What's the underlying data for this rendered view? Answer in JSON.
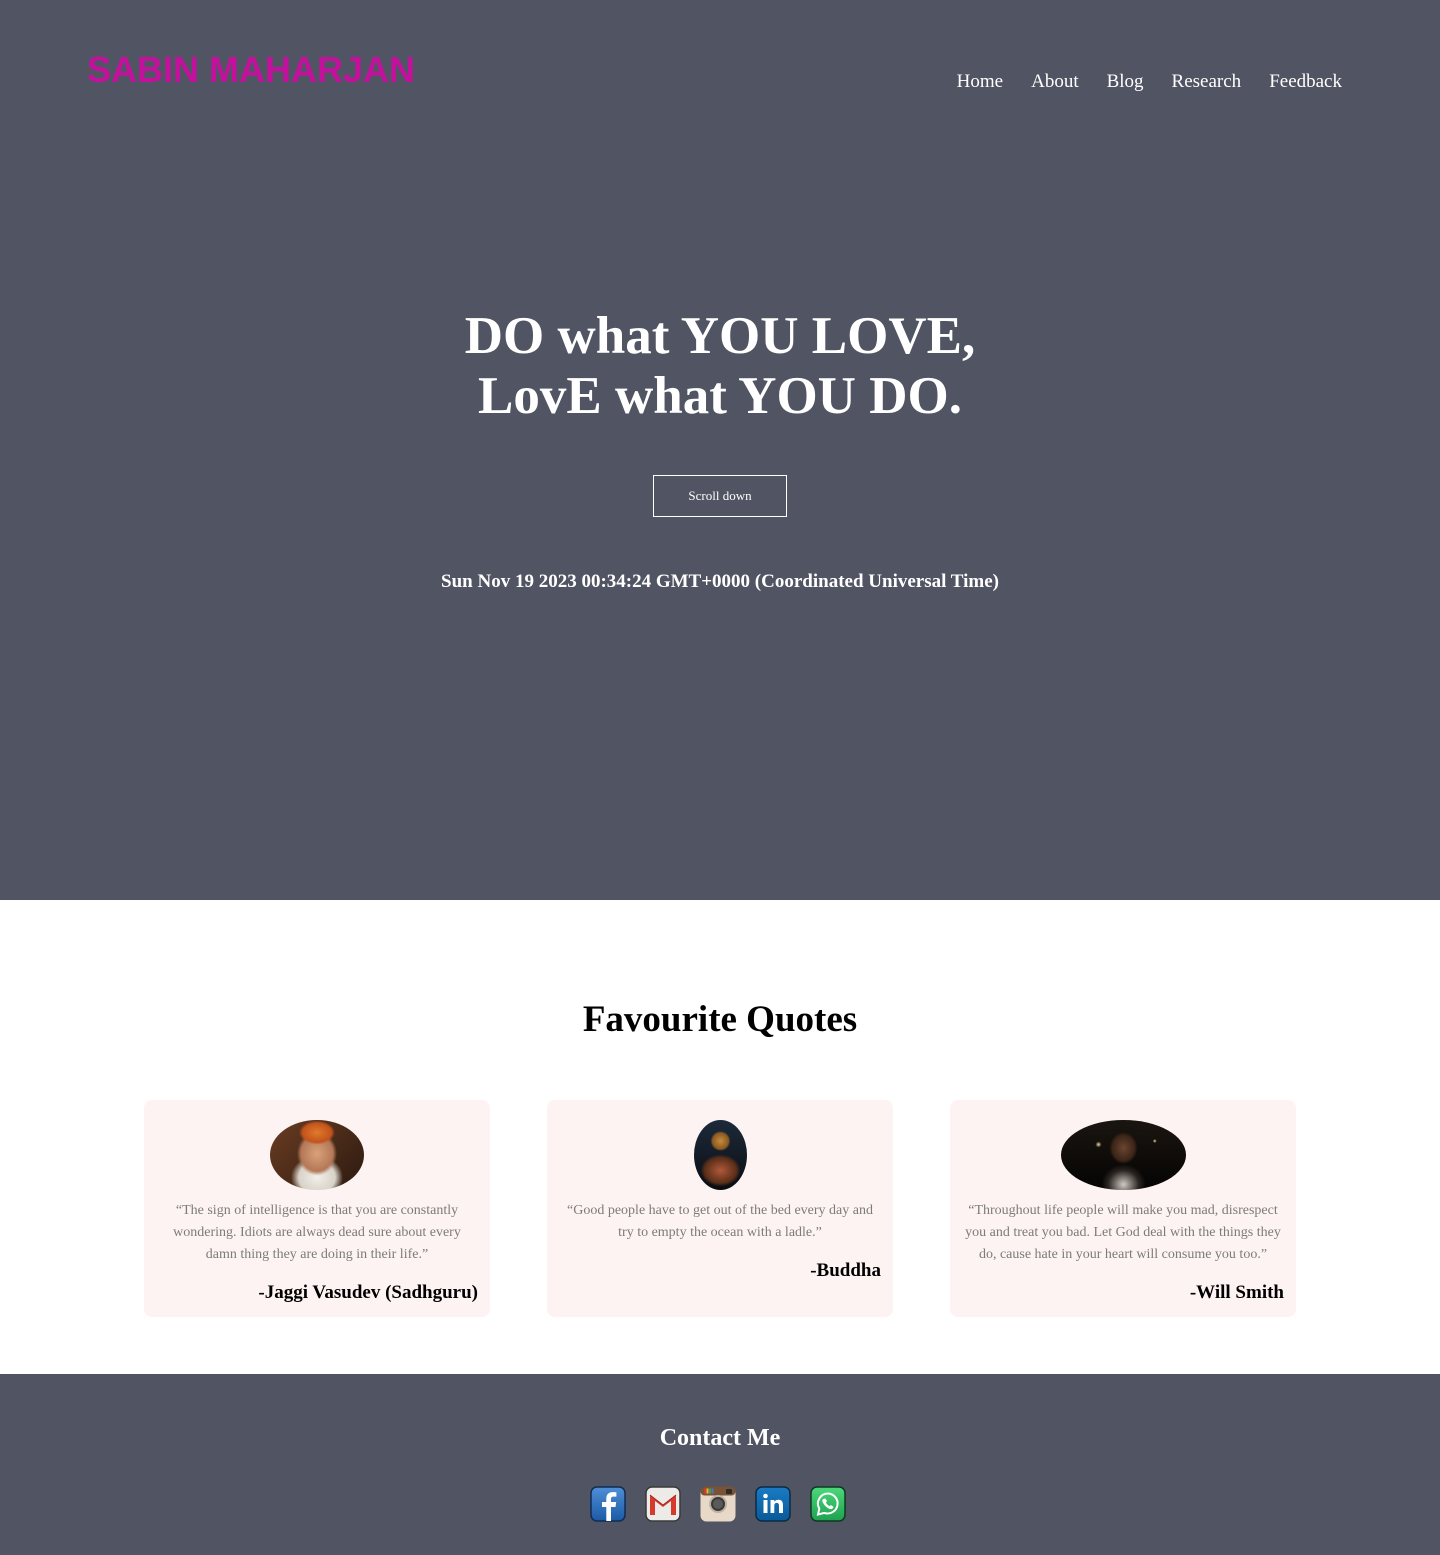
{
  "header": {
    "brand": "SABIN MAHARJAN",
    "nav": [
      "Home",
      "About",
      "Blog",
      "Research",
      "Feedback"
    ]
  },
  "hero": {
    "title_line1": "DO what YOU LOVE,",
    "title_line2": "LovE what YOU DO.",
    "scroll_label": "Scroll down",
    "datetime": "Sun Nov 19 2023 00:34:24 GMT+0000 (Coordinated Universal Time)"
  },
  "quotes": {
    "title": "Favourite Quotes",
    "items": [
      {
        "text": "“The sign of intelligence is that you are constantly wondering. Idiots are always dead sure about every damn thing they are doing in their life.”",
        "author": "-Jaggi Vasudev (Sadhguru)"
      },
      {
        "text": "“Good people have to get out of the bed every day and try to empty the ocean with a ladle.”",
        "author": "-Buddha"
      },
      {
        "text": "“Throughout life people will make you mad, disrespect you and treat you bad. Let God deal with the things they do, cause hate in your heart will consume you too.”",
        "author": "-Will Smith"
      }
    ]
  },
  "contact": {
    "title": "Contact Me",
    "icons": [
      "facebook-icon",
      "gmail-icon",
      "instagram-icon",
      "linkedin-icon",
      "whatsapp-icon"
    ]
  },
  "colors": {
    "hero_bg": "#515462",
    "brand": "#c4119d",
    "card_bg": "#fef3f3",
    "quote_text": "#7b7b7b"
  }
}
